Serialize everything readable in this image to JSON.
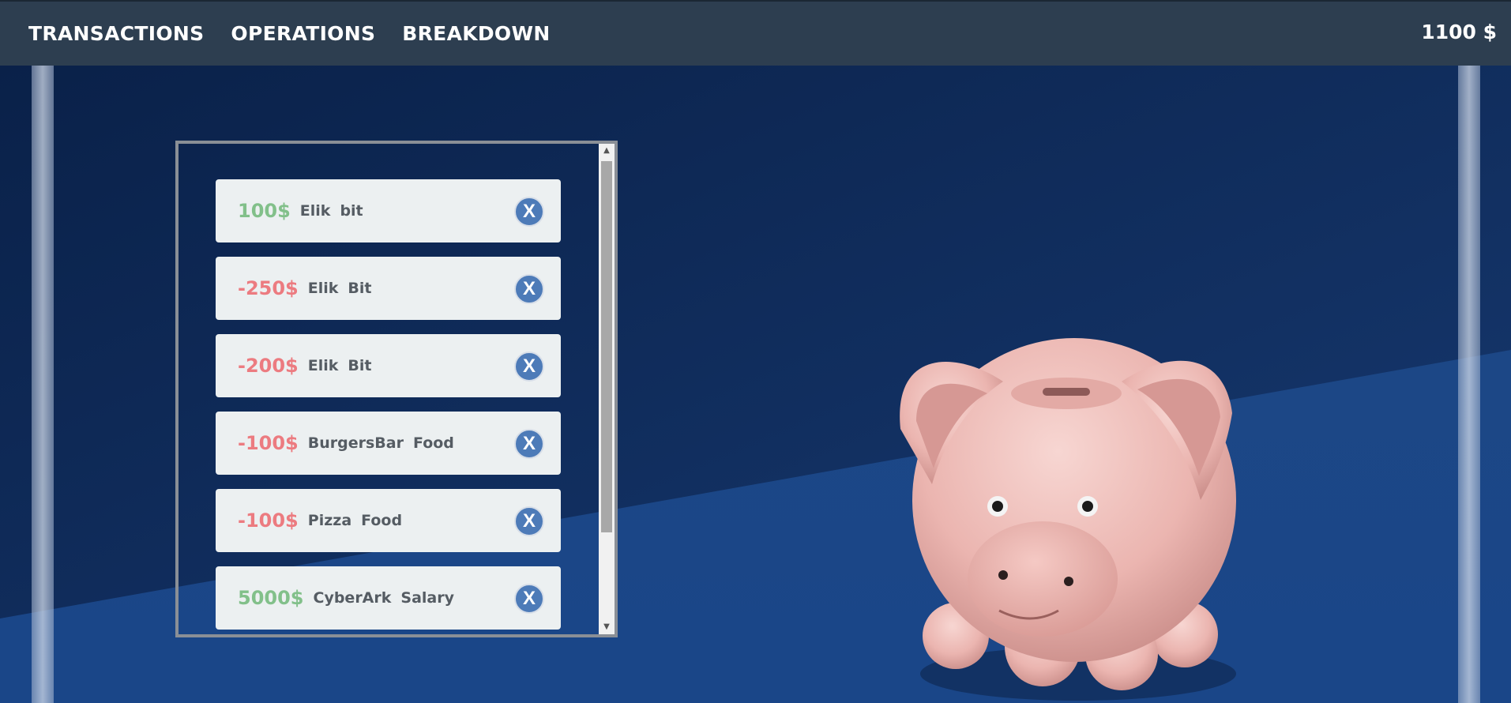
{
  "nav": {
    "transactions_label": "TRANSACTIONS",
    "operations_label": "OPERATIONS",
    "breakdown_label": "BREAKDOWN",
    "balance": "1100 $"
  },
  "transactions": [
    {
      "amount": "100$",
      "vendor": "Elik",
      "category": "bit",
      "type": "positive",
      "delete_label": "X"
    },
    {
      "amount": "-250$",
      "vendor": "Elik",
      "category": "Bit",
      "type": "negative",
      "delete_label": "X"
    },
    {
      "amount": "-200$",
      "vendor": "Elik",
      "category": "Bit",
      "type": "negative",
      "delete_label": "X"
    },
    {
      "amount": "-100$",
      "vendor": "BurgersBar",
      "category": "Food",
      "type": "negative",
      "delete_label": "X"
    },
    {
      "amount": "-100$",
      "vendor": "Pizza",
      "category": "Food",
      "type": "negative",
      "delete_label": "X"
    },
    {
      "amount": "5000$",
      "vendor": "CyberArk",
      "category": "Salary",
      "type": "positive",
      "delete_label": "X"
    }
  ],
  "colors": {
    "navbar": "#2d3e50",
    "positive": "#82c08a",
    "negative": "#ec7b80",
    "delete_button": "#4d7bb8",
    "card": "#ecf0f1"
  },
  "icons": {
    "background": "piggy-bank-image"
  }
}
